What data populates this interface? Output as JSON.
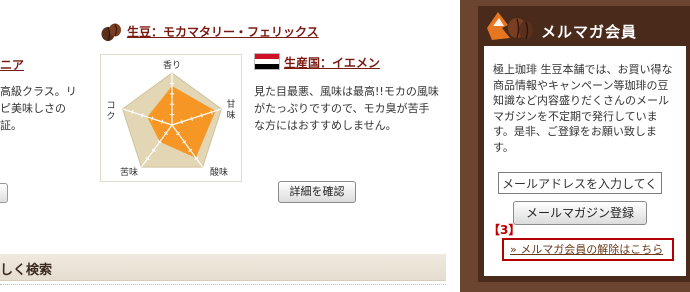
{
  "product": {
    "title": "生豆：モカマタリー・フェリックス",
    "origin_label": "生産国：イエメン",
    "description": "見た目最悪、風味は最高!!モカの風味がたっぷりですので、モカ臭が苦手な方にはおすすめしません。",
    "detail_button": "詳細を確認",
    "radar": {
      "axes": [
        "香り",
        "甘味",
        "酸味",
        "苦味",
        "コク"
      ],
      "values": [
        0.75,
        0.88,
        0.78,
        0.4,
        0.5
      ],
      "colors": {
        "fill": "#f7941d",
        "bg": "#e2d6b5"
      }
    },
    "flag_colors": [
      "#ce1126",
      "#ffffff",
      "#000000"
    ]
  },
  "previous_product": {
    "title_fragment": "ニア",
    "description_fragment": "高級クラス。リピ美味しさの証。"
  },
  "search": {
    "label": "しく検索"
  },
  "mailmag": {
    "header": "メルマガ会員",
    "description": "極上珈琲 生豆本舗では、お買い得な商品情報やキャンペーン等珈琲の豆知識など内容盛りだくさんのメールマガジンを不定期で発行しています。是非、ご登録をお願い致します。",
    "email_placeholder": "メールアドレスを入力してくだ",
    "register_button": "メールマガジン登録",
    "annotation": "【3】",
    "unsubscribe_link": "» メルマガ会員の解除はこちら"
  },
  "colors": {
    "accent": "#7a1b12",
    "panel": "#4a2a1a",
    "highlight": "#b30000"
  }
}
